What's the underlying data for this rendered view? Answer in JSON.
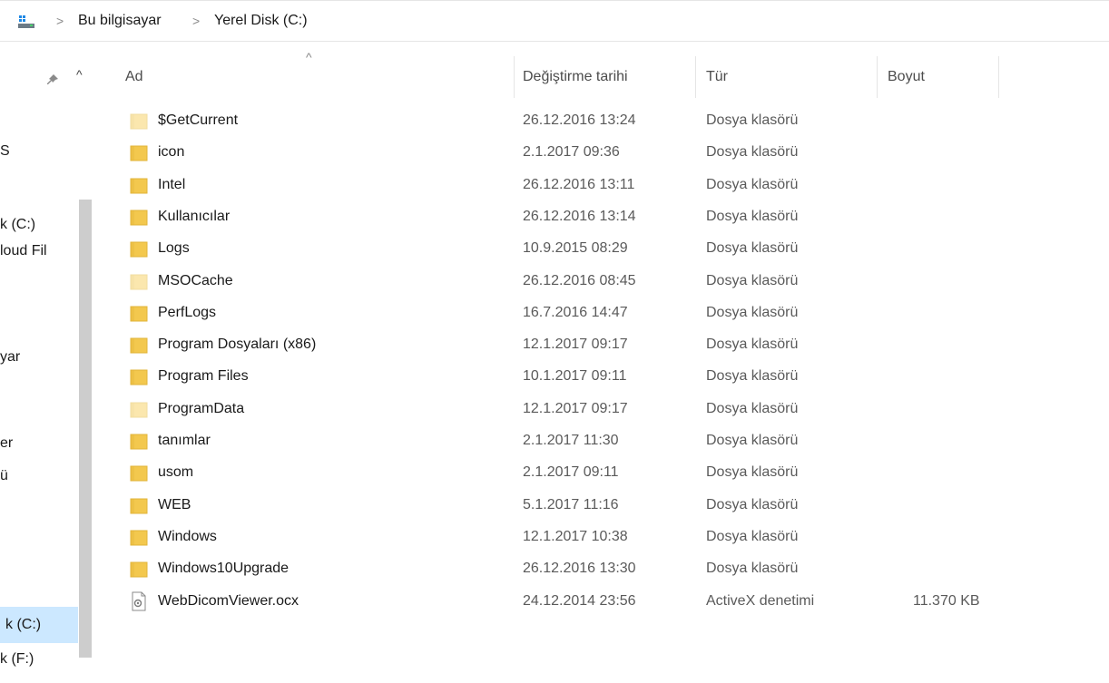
{
  "address": {
    "crumbs": [
      "Bu bilgisayar",
      "Yerel Disk (C:)"
    ],
    "separator": ">"
  },
  "nav": {
    "items": [
      {
        "label": "S"
      },
      {
        "label": "k (C:)"
      },
      {
        "label": "loud Fil"
      },
      {
        "label": "yar"
      },
      {
        "label": "er"
      },
      {
        "label": "ü"
      },
      {
        "label": "k (C:)"
      },
      {
        "label": "k (F:)"
      }
    ]
  },
  "columns": {
    "name": "Ad",
    "date": "Değiştirme tarihi",
    "type": "Tür",
    "size": "Boyut"
  },
  "files": [
    {
      "name": "$GetCurrent",
      "date": "26.12.2016 13:24",
      "type": "Dosya klasörü",
      "size": "",
      "icon": "folder-hidden-icon"
    },
    {
      "name": "icon",
      "date": "2.1.2017 09:36",
      "type": "Dosya klasörü",
      "size": "",
      "icon": "folder-icon"
    },
    {
      "name": "Intel",
      "date": "26.12.2016 13:11",
      "type": "Dosya klasörü",
      "size": "",
      "icon": "folder-icon"
    },
    {
      "name": "Kullanıcılar",
      "date": "26.12.2016 13:14",
      "type": "Dosya klasörü",
      "size": "",
      "icon": "folder-icon"
    },
    {
      "name": "Logs",
      "date": "10.9.2015 08:29",
      "type": "Dosya klasörü",
      "size": "",
      "icon": "folder-icon"
    },
    {
      "name": "MSOCache",
      "date": "26.12.2016 08:45",
      "type": "Dosya klasörü",
      "size": "",
      "icon": "folder-hidden-icon"
    },
    {
      "name": "PerfLogs",
      "date": "16.7.2016 14:47",
      "type": "Dosya klasörü",
      "size": "",
      "icon": "folder-icon"
    },
    {
      "name": "Program Dosyaları (x86)",
      "date": "12.1.2017 09:17",
      "type": "Dosya klasörü",
      "size": "",
      "icon": "folder-icon"
    },
    {
      "name": "Program Files",
      "date": "10.1.2017 09:11",
      "type": "Dosya klasörü",
      "size": "",
      "icon": "folder-icon"
    },
    {
      "name": "ProgramData",
      "date": "12.1.2017 09:17",
      "type": "Dosya klasörü",
      "size": "",
      "icon": "folder-hidden-icon"
    },
    {
      "name": "tanımlar",
      "date": "2.1.2017 11:30",
      "type": "Dosya klasörü",
      "size": "",
      "icon": "folder-icon"
    },
    {
      "name": "usom",
      "date": "2.1.2017 09:11",
      "type": "Dosya klasörü",
      "size": "",
      "icon": "folder-icon"
    },
    {
      "name": "WEB",
      "date": "5.1.2017 11:16",
      "type": "Dosya klasörü",
      "size": "",
      "icon": "folder-icon"
    },
    {
      "name": "Windows",
      "date": "12.1.2017 10:38",
      "type": "Dosya klasörü",
      "size": "",
      "icon": "folder-icon"
    },
    {
      "name": "Windows10Upgrade",
      "date": "26.12.2016 13:30",
      "type": "Dosya klasörü",
      "size": "",
      "icon": "folder-icon"
    },
    {
      "name": "WebDicomViewer.ocx",
      "date": "24.12.2014 23:56",
      "type": "ActiveX denetimi",
      "size": "11.370 KB",
      "icon": "file-ocx-icon"
    }
  ],
  "colors": {
    "folder": "#f3c84e",
    "folder_hidden": "#fbe7ae",
    "selection": "#cce8ff"
  }
}
